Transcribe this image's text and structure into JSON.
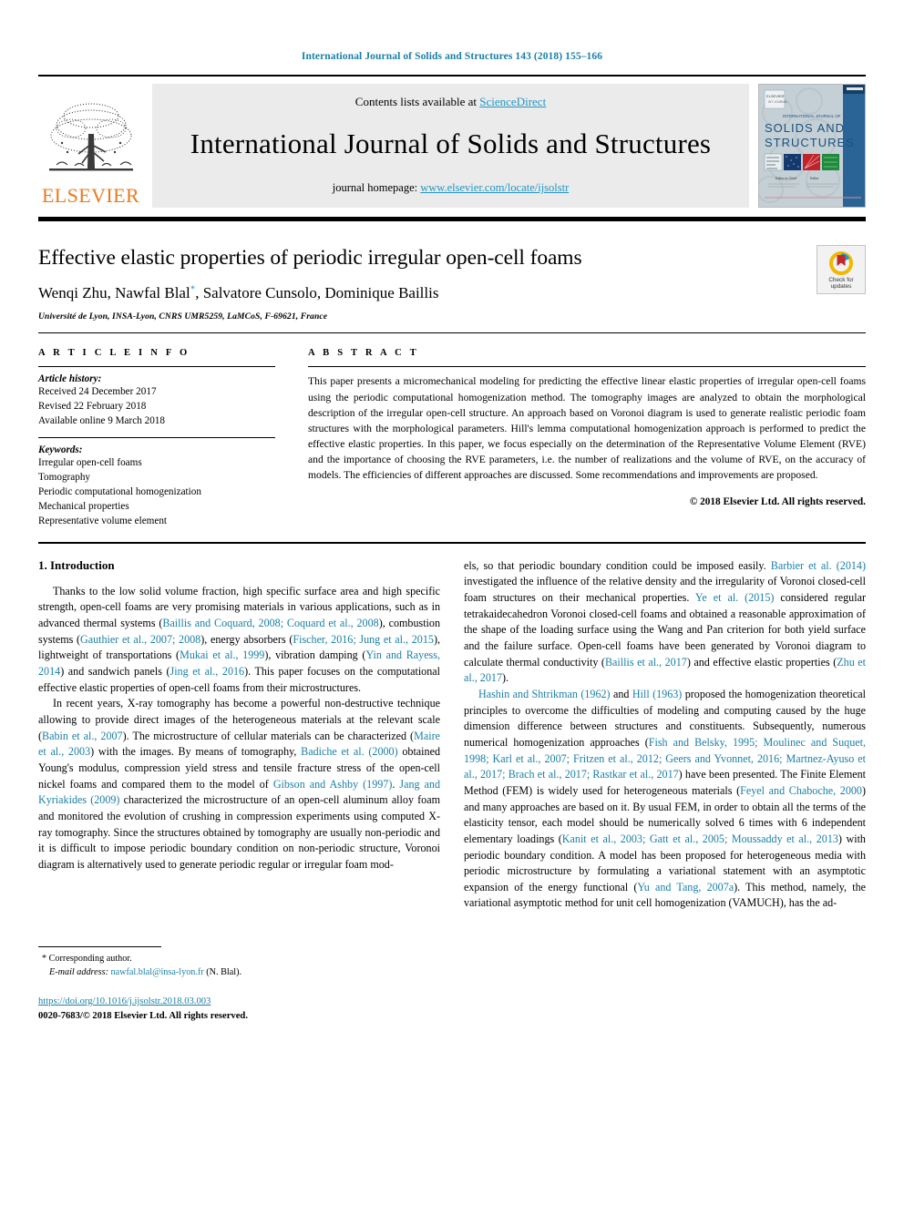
{
  "running_head": "International Journal of Solids and Structures 143 (2018) 155–166",
  "masthead": {
    "contents_prefix": "Contents lists available at ",
    "sciencedirect": "ScienceDirect",
    "journal_name": "International Journal of Solids and Structures",
    "homepage_prefix": "journal homepage: ",
    "homepage_url": "www.elsevier.com/locate/ijsolstr",
    "publisher_wordmark": "ELSEVIER",
    "cover_title_line1": "SOLIDS AND",
    "cover_title_line2": "STRUCTURES"
  },
  "colors": {
    "link": "#1a7fa8",
    "sciencedirect": "#2196c4",
    "elsevier_orange": "#E87B1E",
    "masthead_bg": "#ebebeb"
  },
  "title_block": {
    "title": "Effective elastic properties of periodic irregular open-cell foams",
    "authors_part1": "Wenqi Zhu, Nawfal Blal",
    "author_marker": "*",
    "authors_part2": ", Salvatore Cunsolo, Dominique Baillis",
    "affiliation": "Université de Lyon, INSA-Lyon, CNRS UMR5259, LaMCoS, F-69621, France",
    "crossmark_line1": "Check for",
    "crossmark_line2": "updates"
  },
  "article_info": {
    "heading": "ARTICLE INFO",
    "history_label": "Article history:",
    "history": [
      "Received 24 December 2017",
      "Revised 22 February 2018",
      "Available online 9 March 2018"
    ],
    "keywords_label": "Keywords:",
    "keywords": [
      "Irregular open-cell foams",
      "Tomography",
      "Periodic computational homogenization",
      "Mechanical properties",
      "Representative volume element"
    ]
  },
  "abstract": {
    "heading": "ABSTRACT",
    "body": "This paper presents a micromechanical modeling for predicting the effective linear elastic properties of irregular open-cell foams using the periodic computational homogenization method. The tomography images are analyzed to obtain the morphological description of the irregular open-cell structure. An approach based on Voronoi diagram is used to generate realistic periodic foam structures with the morphological parameters. Hill's lemma computational homogenization approach is performed to predict the effective elastic properties. In this paper, we focus especially on the determination of the Representative Volume Element (RVE) and the importance of choosing the RVE parameters, i.e. the number of realizations and the volume of RVE, on the accuracy of models. The efficiencies of different approaches are discussed. Some recommendations and improvements are proposed.",
    "copyright": "© 2018 Elsevier Ltd. All rights reserved."
  },
  "introduction": {
    "heading": "1. Introduction",
    "left_paragraphs": [
      [
        {
          "t": "Thanks to the low solid volume fraction, high specific surface area and high specific strength, open-cell foams are very promising materials in various applications, such as in advanced thermal systems ("
        },
        {
          "t": "Baillis and Coquard, 2008; Coquard et al., 2008",
          "link": true
        },
        {
          "t": "), combustion systems ("
        },
        {
          "t": "Gauthier et al., 2007; 2008",
          "link": true
        },
        {
          "t": "), energy absorbers ("
        },
        {
          "t": "Fischer, 2016; Jung et al., 2015",
          "link": true
        },
        {
          "t": "), lightweight of transportations ("
        },
        {
          "t": "Mukai et al., 1999",
          "link": true
        },
        {
          "t": "), vibration damping ("
        },
        {
          "t": "Yin and Rayess, 2014",
          "link": true
        },
        {
          "t": ") and sandwich panels ("
        },
        {
          "t": "Jing et al., 2016",
          "link": true
        },
        {
          "t": "). This paper focuses on the computational effective elastic properties of open-cell foams from their microstructures."
        }
      ],
      [
        {
          "t": "In recent years, X-ray tomography has become a powerful non-destructive technique allowing to provide direct images of the heterogeneous materials at the relevant scale ("
        },
        {
          "t": "Babin et al., 2007",
          "link": true
        },
        {
          "t": "). The microstructure of cellular materials can be characterized ("
        },
        {
          "t": "Maire et al., 2003",
          "link": true
        },
        {
          "t": ") with the images. By means of tomography, "
        },
        {
          "t": "Badiche et al. (2000)",
          "link": true
        },
        {
          "t": " obtained Young's modulus, compression yield stress and tensile fracture stress of the open-cell nickel foams and compared them to the model of "
        },
        {
          "t": "Gibson and Ashby (1997)",
          "link": true
        },
        {
          "t": ". "
        },
        {
          "t": "Jang and Kyriakides (2009)",
          "link": true
        },
        {
          "t": " characterized the microstructure of an open-cell aluminum alloy foam and monitored the evolution of crushing in compression experiments using computed X-ray tomography. Since the structures obtained by tomography are usually non-periodic and it is difficult to impose periodic boundary condition on non-periodic structure, Voronoi diagram is alternatively used to generate periodic regular or irregular foam mod-"
        }
      ]
    ],
    "right_paragraphs": [
      [
        {
          "t": "els, so that periodic boundary condition could be imposed easily. "
        },
        {
          "t": "Barbier et al. (2014)",
          "link": true
        },
        {
          "t": " investigated the influence of the relative density and the irregularity of Voronoi closed-cell foam structures on their mechanical properties. "
        },
        {
          "t": "Ye et al. (2015)",
          "link": true
        },
        {
          "t": " considered regular tetrakaidecahedron Voronoi closed-cell foams and obtained a reasonable approximation of the shape of the loading surface using the Wang and Pan criterion for both yield surface and the failure surface. Open-cell foams have been generated by Voronoi diagram to calculate thermal conductivity ("
        },
        {
          "t": "Baillis et al., 2017",
          "link": true
        },
        {
          "t": ") and effective elastic properties ("
        },
        {
          "t": "Zhu et al., 2017",
          "link": true
        },
        {
          "t": ")."
        }
      ],
      [
        {
          "t": "Hashin and Shtrikman (1962)",
          "link": true
        },
        {
          "t": " and "
        },
        {
          "t": "Hill (1963)",
          "link": true
        },
        {
          "t": " proposed the homogenization theoretical principles to overcome the difficulties of modeling and computing caused by the huge dimension difference between structures and constituents. Subsequently, numerous numerical homogenization approaches ("
        },
        {
          "t": "Fish and Belsky, 1995; Moulinec and Suquet, 1998; Karl et al., 2007; Fritzen et al., 2012; Geers and Yvonnet, 2016; Martnez-Ayuso et al., 2017; Brach et al., 2017; Rastkar et al., 2017",
          "link": true
        },
        {
          "t": ") have been presented. The Finite Element Method (FEM) is widely used for heterogeneous materials ("
        },
        {
          "t": "Feyel and Chaboche, 2000",
          "link": true
        },
        {
          "t": ") and many approaches are based on it. By usual FEM, in order to obtain all the terms of the elasticity tensor, each model should be numerically solved 6 times with 6 independent elementary loadings ("
        },
        {
          "t": "Kanit et al., 2003; Gatt et al., 2005; Moussaddy et al., 2013",
          "link": true
        },
        {
          "t": ") with periodic boundary condition. A model has been proposed for heterogeneous media with periodic microstructure by formulating a variational statement with an asymptotic expansion of the energy functional ("
        },
        {
          "t": "Yu and Tang, 2007a",
          "link": true
        },
        {
          "t": "). This method, namely, the variational asymptotic method for unit cell homogenization (VAMUCH), has the ad-"
        }
      ]
    ]
  },
  "footnote": {
    "star": "*",
    "corresponding": "Corresponding author.",
    "email_label": "E-mail address:",
    "email": "nawfal.blal@insa-lyon.fr",
    "email_owner": "(N. Blal).",
    "doi": "https://doi.org/10.1016/j.ijsolstr.2018.03.003",
    "issn": "0020-7683/© 2018 Elsevier Ltd. All rights reserved."
  }
}
